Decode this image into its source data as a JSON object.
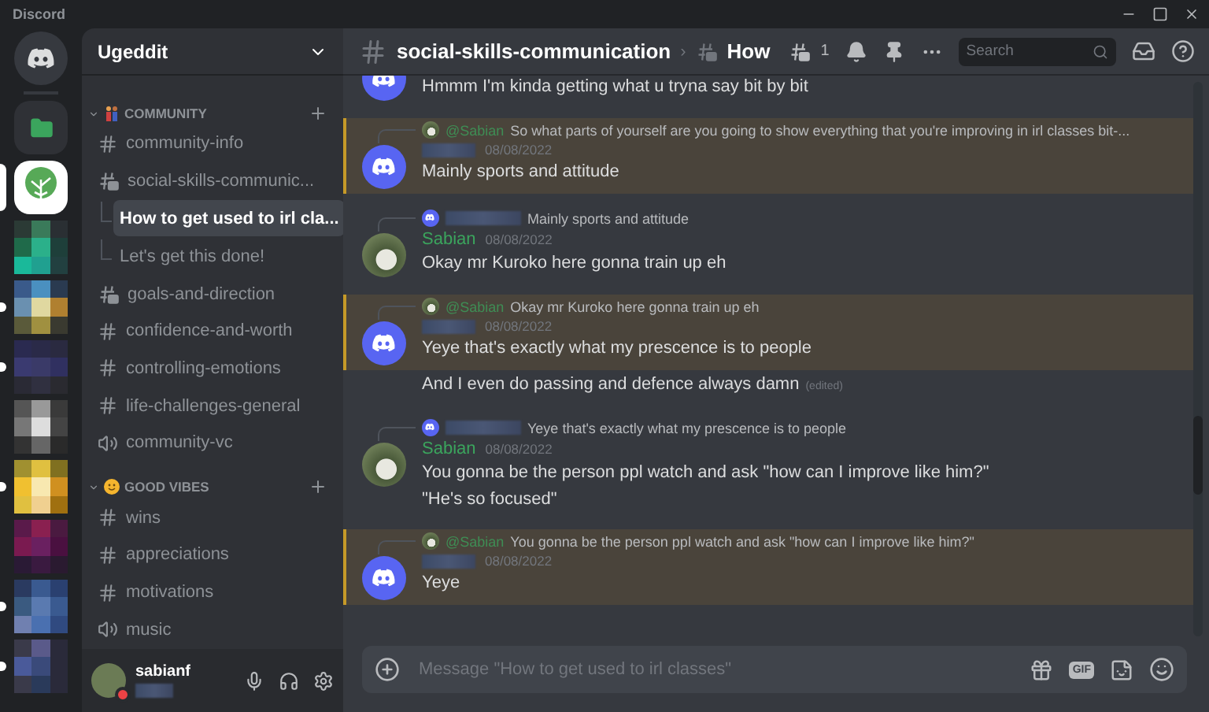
{
  "window": {
    "title": "Discord"
  },
  "servers": [
    {
      "kind": "home",
      "selected": false,
      "unread": false
    },
    {
      "kind": "folder",
      "selected": false,
      "unread": false
    },
    {
      "kind": "tree",
      "selected": true,
      "unread": false
    },
    {
      "kind": "mosaic",
      "selected": false,
      "unread": false
    },
    {
      "kind": "mosaic",
      "selected": false,
      "unread": true
    },
    {
      "kind": "mosaic",
      "selected": false,
      "unread": true
    },
    {
      "kind": "mosaic",
      "selected": false,
      "unread": false
    },
    {
      "kind": "mosaic",
      "selected": false,
      "unread": true
    },
    {
      "kind": "mosaic",
      "selected": false,
      "unread": false
    },
    {
      "kind": "mosaic",
      "selected": false,
      "unread": true
    },
    {
      "kind": "mosaic",
      "selected": false,
      "unread": true
    }
  ],
  "server": {
    "name": "Ugeddit"
  },
  "categories": [
    {
      "name": "COMMUNITY",
      "emoji": {
        "kind": "people"
      },
      "channels": [
        {
          "kind": "text",
          "name": "community-info",
          "selected": false
        },
        {
          "kind": "forum",
          "name": "social-skills-communic...",
          "selected": false,
          "children": [
            {
              "name": "How to get used to irl cla...",
              "selected": true
            },
            {
              "name": "Let's get this done!",
              "selected": false
            }
          ]
        },
        {
          "kind": "forum",
          "name": "goals-and-direction",
          "selected": false
        },
        {
          "kind": "text",
          "name": "confidence-and-worth",
          "selected": false
        },
        {
          "kind": "text",
          "name": "controlling-emotions",
          "selected": false
        },
        {
          "kind": "text",
          "name": "life-challenges-general",
          "selected": false
        },
        {
          "kind": "voice",
          "name": "community-vc",
          "selected": false
        }
      ]
    },
    {
      "name": "GOOD VIBES",
      "emoji": {
        "kind": "smile"
      },
      "channels": [
        {
          "kind": "text",
          "name": "wins",
          "selected": false
        },
        {
          "kind": "text",
          "name": "appreciations",
          "selected": false
        },
        {
          "kind": "text",
          "name": "motivations",
          "selected": false
        },
        {
          "kind": "voice",
          "name": "music",
          "selected": false
        }
      ]
    }
  ],
  "user": {
    "name": "sabianf",
    "do_not_disturb": true
  },
  "header": {
    "channel": "social-skills-communication",
    "separator": "›",
    "thread": "How",
    "thread_count": "1",
    "search_placeholder": "Search"
  },
  "messages": [
    {
      "kind": "tail",
      "avatar": {
        "kind": "discord"
      },
      "highlighted": false,
      "lines": [
        "Hmmm I'm kinda getting what u tryna say bit by bit"
      ]
    },
    {
      "kind": "reply",
      "avatar": {
        "kind": "discord"
      },
      "highlighted": true,
      "reply": {
        "avatar": {
          "kind": "photo"
        },
        "mention": "@Sabian",
        "text": "So what parts of yourself are you going to show everything that you're improving in irl classes bit-..."
      },
      "date": "08/08/2022",
      "lines": [
        "Mainly sports and attitude"
      ]
    },
    {
      "kind": "reply",
      "avatar": {
        "kind": "photo"
      },
      "highlighted": false,
      "reply": {
        "avatar": {
          "kind": "discord"
        },
        "text": "Mainly sports and attitude"
      },
      "author": "Sabian",
      "date": "08/08/2022",
      "lines": [
        "Okay mr Kuroko here gonna train up eh"
      ]
    },
    {
      "kind": "reply",
      "avatar": {
        "kind": "discord"
      },
      "highlighted": true,
      "reply": {
        "avatar": {
          "kind": "photo"
        },
        "mention": "@Sabian",
        "text": "Okay mr Kuroko here gonna train up eh"
      },
      "date": "08/08/2022",
      "lines": [
        "Yeye that's exactly what my prescence is to people"
      ]
    },
    {
      "kind": "plain",
      "highlighted": false,
      "lines": [
        "And I even do passing and defence always damn"
      ],
      "edited": "(edited)"
    },
    {
      "kind": "reply",
      "avatar": {
        "kind": "photo"
      },
      "highlighted": false,
      "reply": {
        "avatar": {
          "kind": "discord"
        },
        "text": "Yeye that's exactly what my prescence is to people"
      },
      "author": "Sabian",
      "date": "08/08/2022",
      "lines": [
        "You gonna be the person ppl watch and ask \"how can I improve like him?\"",
        "\"He's so focused\""
      ]
    },
    {
      "kind": "reply",
      "avatar": {
        "kind": "discord"
      },
      "highlighted": true,
      "reply": {
        "avatar": {
          "kind": "photo"
        },
        "mention": "@Sabian",
        "text": "You gonna be the person ppl watch and ask \"how can I improve like him?\""
      },
      "date": "08/08/2022",
      "lines": [
        "Yeye"
      ]
    }
  ],
  "composer": {
    "placeholder": "Message \"How to get used to irl classes\"",
    "gif_label": "GIF"
  }
}
